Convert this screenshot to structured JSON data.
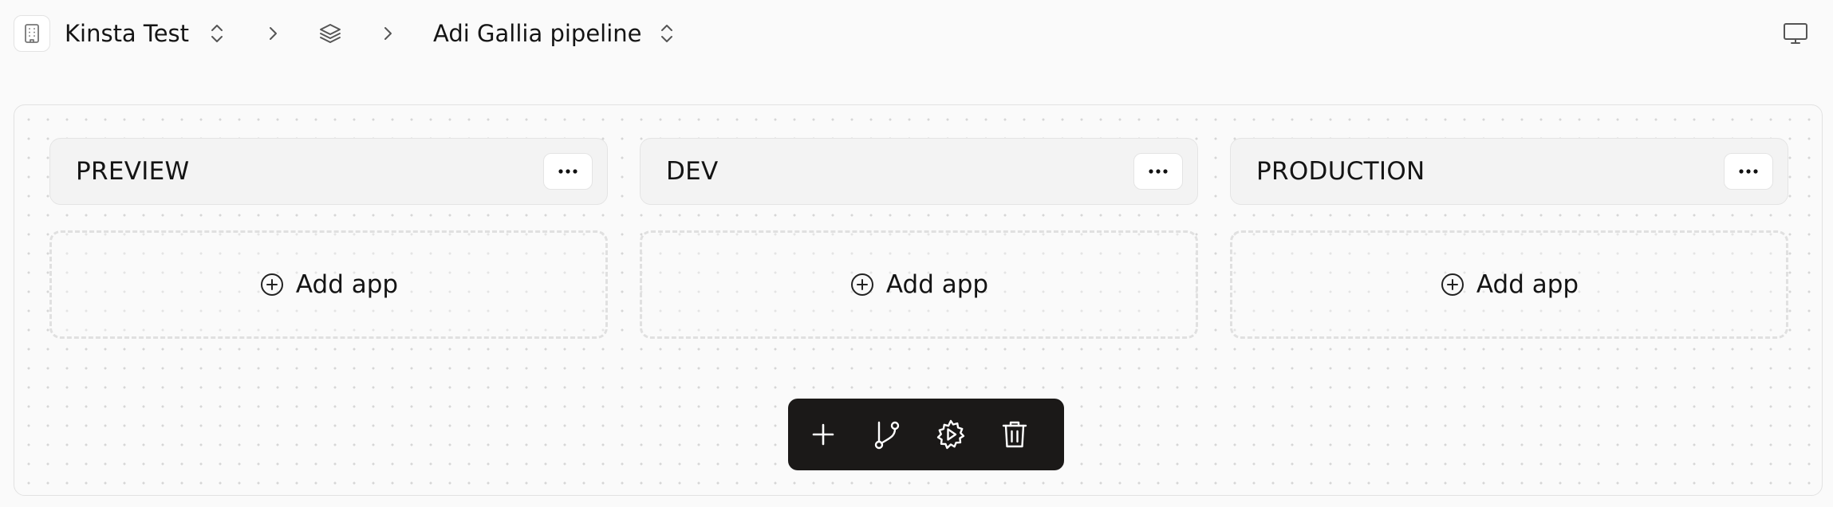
{
  "header": {
    "org_name": "Kinsta Test",
    "org_icon": "building-icon",
    "pipeline_name": "Adi Gallia pipeline",
    "layers_icon": "layers-icon",
    "right_icon": "monitor-icon"
  },
  "stages": [
    {
      "title": "PREVIEW",
      "add_label": "Add app"
    },
    {
      "title": "DEV",
      "add_label": "Add app"
    },
    {
      "title": "PRODUCTION",
      "add_label": "Add app"
    }
  ],
  "toolbar": {
    "items": [
      "plus-icon",
      "git-branch-icon",
      "gear-play-icon",
      "trash-icon"
    ]
  },
  "colors": {
    "toolbar_bg": "#1b1918",
    "stage_header_bg": "#f3f3f3",
    "page_bg": "#fafafa"
  }
}
